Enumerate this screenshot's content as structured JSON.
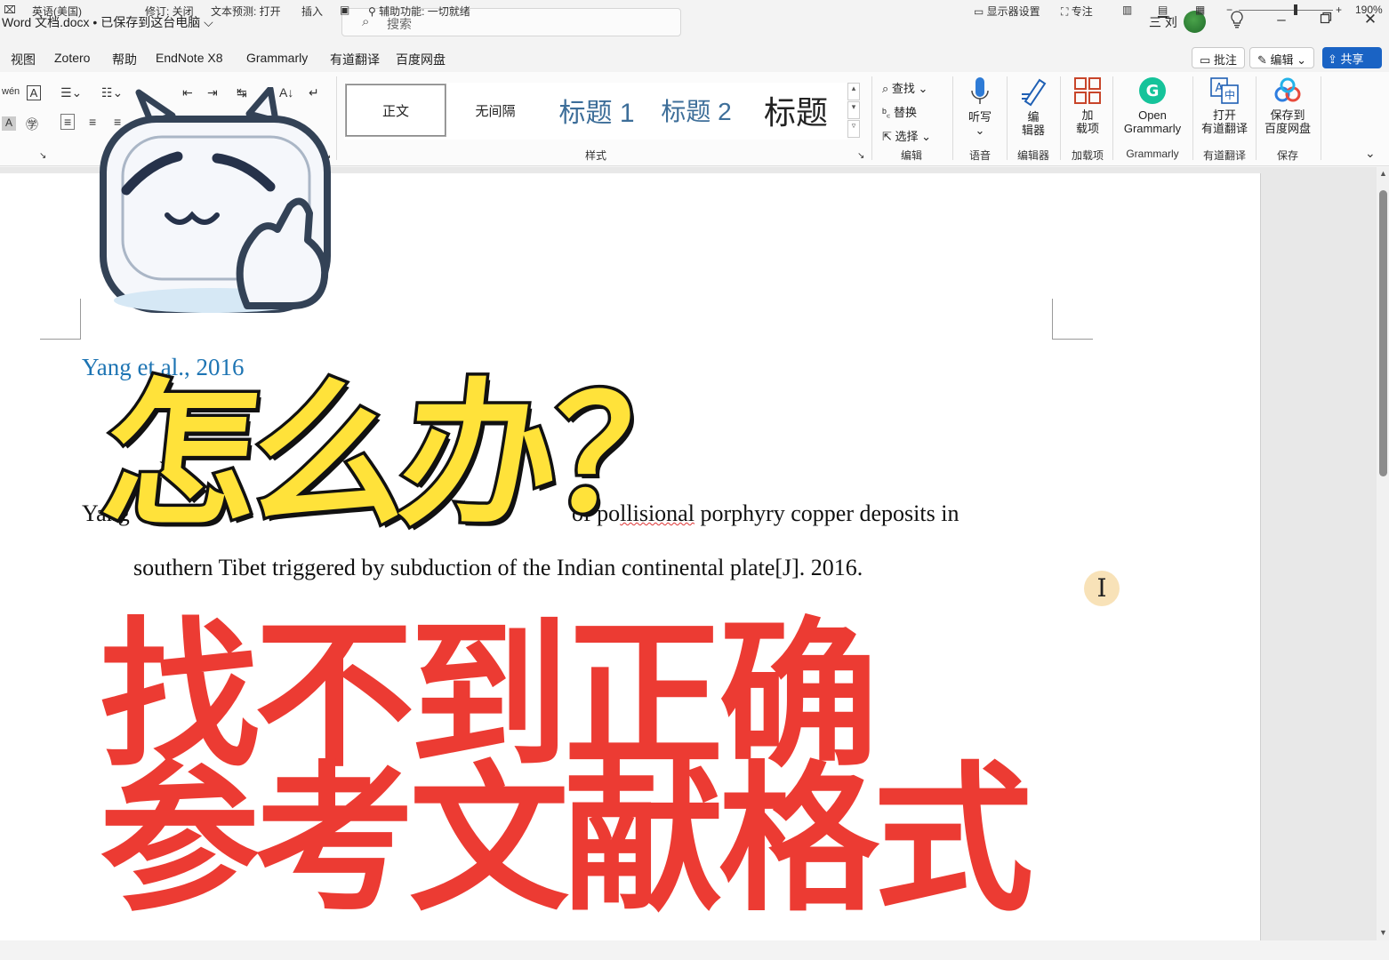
{
  "titlebar": {
    "doc_title": "Word 文档.docx • 已保存到这台电脑 ⌵",
    "search_placeholder": "搜索",
    "user_name": "三 刘"
  },
  "menu": {
    "items": [
      "视图",
      "Zotero",
      "帮助",
      "EndNote X8",
      "Grammarly",
      "有道翻译",
      "百度网盘"
    ],
    "comment_label": "批注",
    "edit_label": "编辑 ⌄",
    "share_label": "共享 ⌄"
  },
  "ribbon": {
    "styles": [
      "正文",
      "无间隔",
      "标题 1",
      "标题 2",
      "标题"
    ],
    "styles_group_label": "样式",
    "edit_cmds": [
      "查找 ⌄",
      "替换",
      "选择 ⌄"
    ],
    "edit_group_label": "编辑",
    "dictate_label": "听写",
    "dictate_group_label": "语音",
    "editor_label_line1": "编",
    "editor_label_line2": "辑器",
    "editor_group_label": "编辑器",
    "addins_label_line1": "加",
    "addins_label_line2": "载项",
    "addins_group_label": "加载项",
    "grammarly_label_line1": "Open",
    "grammarly_label_line2": "Grammarly",
    "grammarly_group_label": "Grammarly",
    "youdao_label_line1": "打开",
    "youdao_label_line2": "有道翻译",
    "youdao_group_label": "有道翻译",
    "baidu_label_line1": "保存到",
    "baidu_label_line2": "百度网盘",
    "baidu_group_label": "保存"
  },
  "document": {
    "citation": "Yang et al., 2016",
    "ref_line1_start": "Yang",
    "ref_line1_mid": "of po",
    "ref_line1_err": "llisional",
    "ref_line1_end": " porphyry copper deposits in",
    "ref_line2": "southern Tibet triggered by subduction of the Indian continental plate[J]. 2016."
  },
  "overlay": {
    "question": "怎么办？",
    "headline_line1": "找不到正确",
    "headline_line2": "参考文献格式"
  },
  "statusbar": {
    "language": "英语(美国)",
    "track_changes": "修订: 关闭",
    "text_prediction": "文本预测: 打开",
    "insert_mode": "插入",
    "accessibility": "辅助功能: 一切就绪",
    "display_settings": "显示器设置",
    "focus": "专注",
    "zoom": "190%"
  },
  "colors": {
    "share_button": "#1a63c4",
    "citation_text": "#1d74b3",
    "overlay_yellow": "#ffe23a",
    "overlay_red": "#ec3b33"
  }
}
